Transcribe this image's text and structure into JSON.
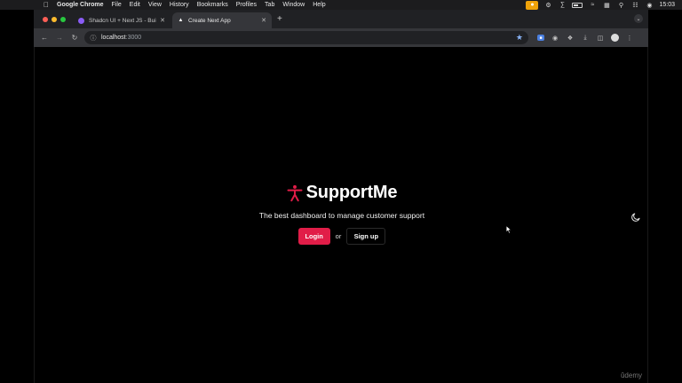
{
  "menubar": {
    "apple_icon": "apple-icon",
    "items": [
      "Google Chrome",
      "File",
      "Edit",
      "View",
      "History",
      "Bookmarks",
      "Profiles",
      "Tab",
      "Window",
      "Help"
    ],
    "clock": "15:03"
  },
  "tabs": [
    {
      "title": "Shadcn UI + Next JS - Build I",
      "active": false
    },
    {
      "title": "Create Next App",
      "active": true
    }
  ],
  "address": {
    "host": "localhost",
    "port": ":3000"
  },
  "page": {
    "brand": "SupportMe",
    "tagline": "The best dashboard to manage customer support",
    "login_label": "Login",
    "or_label": "or",
    "signup_label": "Sign up"
  },
  "colors": {
    "accent": "#e11d48",
    "background": "#000000"
  },
  "watermark": "ûdemy"
}
